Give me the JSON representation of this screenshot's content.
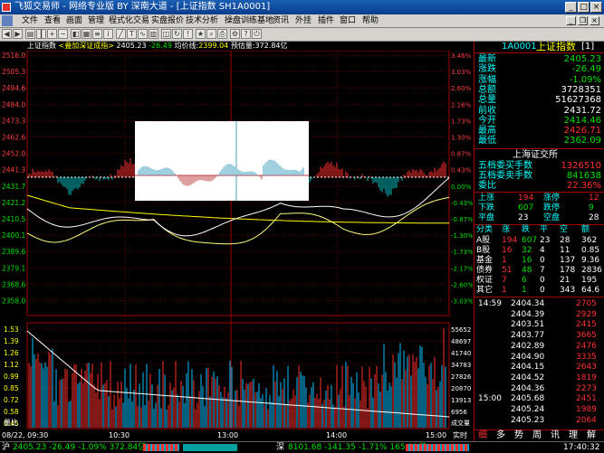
{
  "window": {
    "title": "飞狐交易师 - 网络专业版 BY 深南大道 - [上证指数 SH1A0001]"
  },
  "window_buttons": {
    "minimize": "_",
    "maximize": "□",
    "close": "×"
  },
  "menu": {
    "items": [
      "文件",
      "查看",
      "画面",
      "管理",
      "程式化交易",
      "实盘报价",
      "技术分析",
      "操盘训练基地",
      "资讯",
      "外挂",
      "插件",
      "窗口",
      "帮助"
    ]
  },
  "mdi_buttons": {
    "minimize": "_",
    "restore": "❐",
    "close": "×"
  },
  "chart_header": {
    "name": "上证指数",
    "overlay": "<叠加深证成指>",
    "price": "2405.23",
    "change": "-26.49",
    "avg_label": "均价线:",
    "avg": "2399.04",
    "est_label": "预估量:",
    "est": "372.84亿"
  },
  "price_axis": {
    "left": [
      "2516.0",
      "2505.3",
      "2494.6",
      "2484.0",
      "2473.3",
      "2462.6",
      "2452.0",
      "2441.3",
      "2431.7",
      "2421.2",
      "2410.5",
      "2400.1",
      "2389.6",
      "2379.1",
      "2368.6",
      "2358.0"
    ],
    "right": [
      "3.46%",
      "3.03%",
      "2.60%",
      "2.16%",
      "1.73%",
      "1.30%",
      "0.87%",
      "0.43%",
      "0.00%",
      "-0.43%",
      "-0.87%",
      "-1.30%",
      "-1.73%",
      "-2.17%",
      "-2.60%",
      "-3.03%"
    ]
  },
  "volume_axis": {
    "left": [
      "1.53",
      "1.39",
      "1.26",
      "1.12",
      "0.99",
      "0.85",
      "0.72",
      "0.58",
      "0.45"
    ],
    "right": [
      "55652",
      "48697",
      "41740",
      "34783",
      "27826",
      "20870",
      "13913",
      "6956"
    ],
    "left_label": "量比",
    "right_label": "成交量"
  },
  "time_axis": {
    "labels": [
      "08/22, 09:30",
      "10:30",
      "13:00",
      "14:00",
      "15:00"
    ],
    "realtime": "实时"
  },
  "right_panel": {
    "header": {
      "code": "1A0001",
      "name": "上证指数",
      "tag": "[1]"
    },
    "quote": [
      {
        "label": "最新",
        "value": "2405.23"
      },
      {
        "label": "涨跌",
        "value": "-26.49"
      },
      {
        "label": "涨幅",
        "value": "-1.09%"
      },
      {
        "label": "总额",
        "value": "3728351"
      },
      {
        "label": "总量",
        "value": "51627368"
      },
      {
        "label": "前收",
        "value": "2431.72"
      },
      {
        "label": "今开",
        "value": "2414.46"
      },
      {
        "label": "最高",
        "value": "2426.71"
      },
      {
        "label": "最低",
        "value": "2362.09"
      }
    ],
    "exchange": "上海证交所",
    "orders": [
      {
        "label": "五档委买手数",
        "value": "1326510"
      },
      {
        "label": "五档委卖手数",
        "value": "841638"
      },
      {
        "label": "委比",
        "value": "22.36%"
      }
    ],
    "updown": [
      {
        "l1": "上涨",
        "v1": "194",
        "l2": "涨停",
        "v2": "12"
      },
      {
        "l1": "下跌",
        "v1": "607",
        "l2": "跌停",
        "v2": "9"
      },
      {
        "l1": "平盘",
        "v1": "23",
        "l2": "空盘",
        "v2": "28"
      }
    ],
    "class_header": [
      "分类",
      "涨",
      "跌",
      "平",
      "空",
      "额"
    ],
    "class_rows": [
      [
        "A股",
        "194",
        "607",
        "23",
        "28",
        "362"
      ],
      [
        "B股",
        "16",
        "32",
        "4",
        "11",
        "0.85"
      ],
      [
        "基金",
        "1",
        "16",
        "0",
        "137",
        "9.36"
      ],
      [
        "债券",
        "51",
        "48",
        "7",
        "178",
        "2836"
      ],
      [
        "权证",
        "7",
        "6",
        "0",
        "21",
        "195"
      ],
      [
        "其它",
        "1",
        "1",
        "0",
        "343",
        "64.6"
      ]
    ],
    "ticks": [
      {
        "time": "14:59",
        "price": "2404.34",
        "vol": "2705"
      },
      {
        "time": "",
        "price": "2404.39",
        "vol": "2929"
      },
      {
        "time": "",
        "price": "2403.51",
        "vol": "2415"
      },
      {
        "time": "",
        "price": "2403.77",
        "vol": "3665"
      },
      {
        "time": "",
        "price": "2402.89",
        "vol": "2476"
      },
      {
        "time": "",
        "price": "2404.90",
        "vol": "3335"
      },
      {
        "time": "",
        "price": "2404.15",
        "vol": "2643"
      },
      {
        "time": "",
        "price": "2404.52",
        "vol": "1819"
      },
      {
        "time": "",
        "price": "2404.36",
        "vol": "2273"
      },
      {
        "time": "15:00",
        "price": "2405.68",
        "vol": "2451"
      },
      {
        "time": "",
        "price": "2405.24",
        "vol": "1989"
      },
      {
        "time": "",
        "price": "2405.23",
        "vol": "2064"
      }
    ],
    "tabs": [
      "细",
      "多",
      "势",
      "周",
      "讯",
      "理",
      "解"
    ]
  },
  "bottom": {
    "sh_label": "沪",
    "sh": "2405.23 -26.49 -1.09% 372.84亿",
    "sz_label": "深",
    "sz": "8101.68 -141.35 -1.71% 165.99亿",
    "clock": "17:40:32"
  },
  "colors": {
    "up": "#ff3030",
    "down": "#00e000",
    "price_line": "#ffffff",
    "avg_line": "#ffff00",
    "grid": "#8b0000"
  }
}
